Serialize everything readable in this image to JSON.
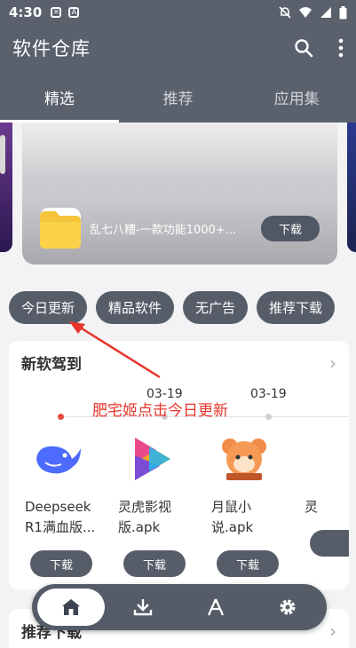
{
  "status_bar": {
    "time": "4:30"
  },
  "app_bar": {
    "title": "软件仓库"
  },
  "tabs": [
    {
      "label": "精选",
      "active": true
    },
    {
      "label": "推荐",
      "active": false
    },
    {
      "label": "应用集",
      "active": false
    }
  ],
  "banner": {
    "app_name": "乱七八糟-一款功能1000+...",
    "download_label": "下载"
  },
  "chips": [
    "今日更新",
    "精品软件",
    "无广告",
    "推荐下载"
  ],
  "new_section": {
    "title": "新软驾到",
    "dates": [
      "03-19",
      "03-19"
    ],
    "apps": [
      {
        "name": "Deepseek R1满血版...",
        "download": "下载"
      },
      {
        "name": "灵虎影视版.apk",
        "download": "下载"
      },
      {
        "name": "月鼠小说.apk",
        "download": "下载"
      },
      {
        "name": "灵",
        "download": ""
      }
    ]
  },
  "annotation": "肥宅姬点击今日更新",
  "second_section": {
    "title": "推荐下载"
  },
  "colors": {
    "bar": "#5a616d",
    "chip": "#565d69",
    "annotation": "#e8342a"
  }
}
